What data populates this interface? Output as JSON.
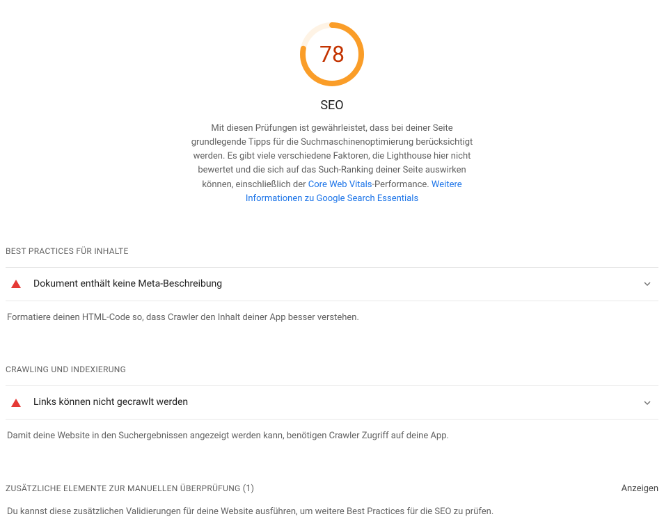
{
  "score": {
    "value": "78",
    "pct": 78,
    "color": "#fa9d28",
    "text_color": "#c33300"
  },
  "category": {
    "title": "SEO",
    "desc_pre": "Mit diesen Prüfungen ist gewährleistet, dass bei deiner Seite grundlegende Tipps für die Suchmaschinenoptimierung berücksichtigt werden. Es gibt viele verschiedene Faktoren, die Lighthouse hier nicht bewertet und die sich auf das Such-Ranking deiner Seite auswirken können, einschließlich der ",
    "link1": "Core Web Vitals",
    "desc_mid": "-Performance. ",
    "link2": "Weitere Informationen zu Google Search Essentials"
  },
  "section1": {
    "title": "BEST PRACTICES FÜR INHALTE",
    "audit": "Dokument enthält keine Meta-Beschreibung",
    "note": "Formatiere deinen HTML-Code so, dass Crawler den Inhalt deiner App besser verstehen."
  },
  "section2": {
    "title": "CRAWLING UND INDEXIERUNG",
    "audit": "Links können nicht gecrawlt werden",
    "note": "Damit deine Website in den Suchergebnissen angezeigt werden kann, benötigen Crawler Zugriff auf deine App."
  },
  "section3": {
    "title": "ZUSÄTZLICHE ELEMENTE ZUR MANUELLEN ÜBERPRÜFUNG",
    "count": "(1)",
    "action": "Anzeigen",
    "note": "Du kannst diese zusätzlichen Validierungen für deine Website ausführen, um weitere Best Practices für die SEO zu prüfen."
  }
}
